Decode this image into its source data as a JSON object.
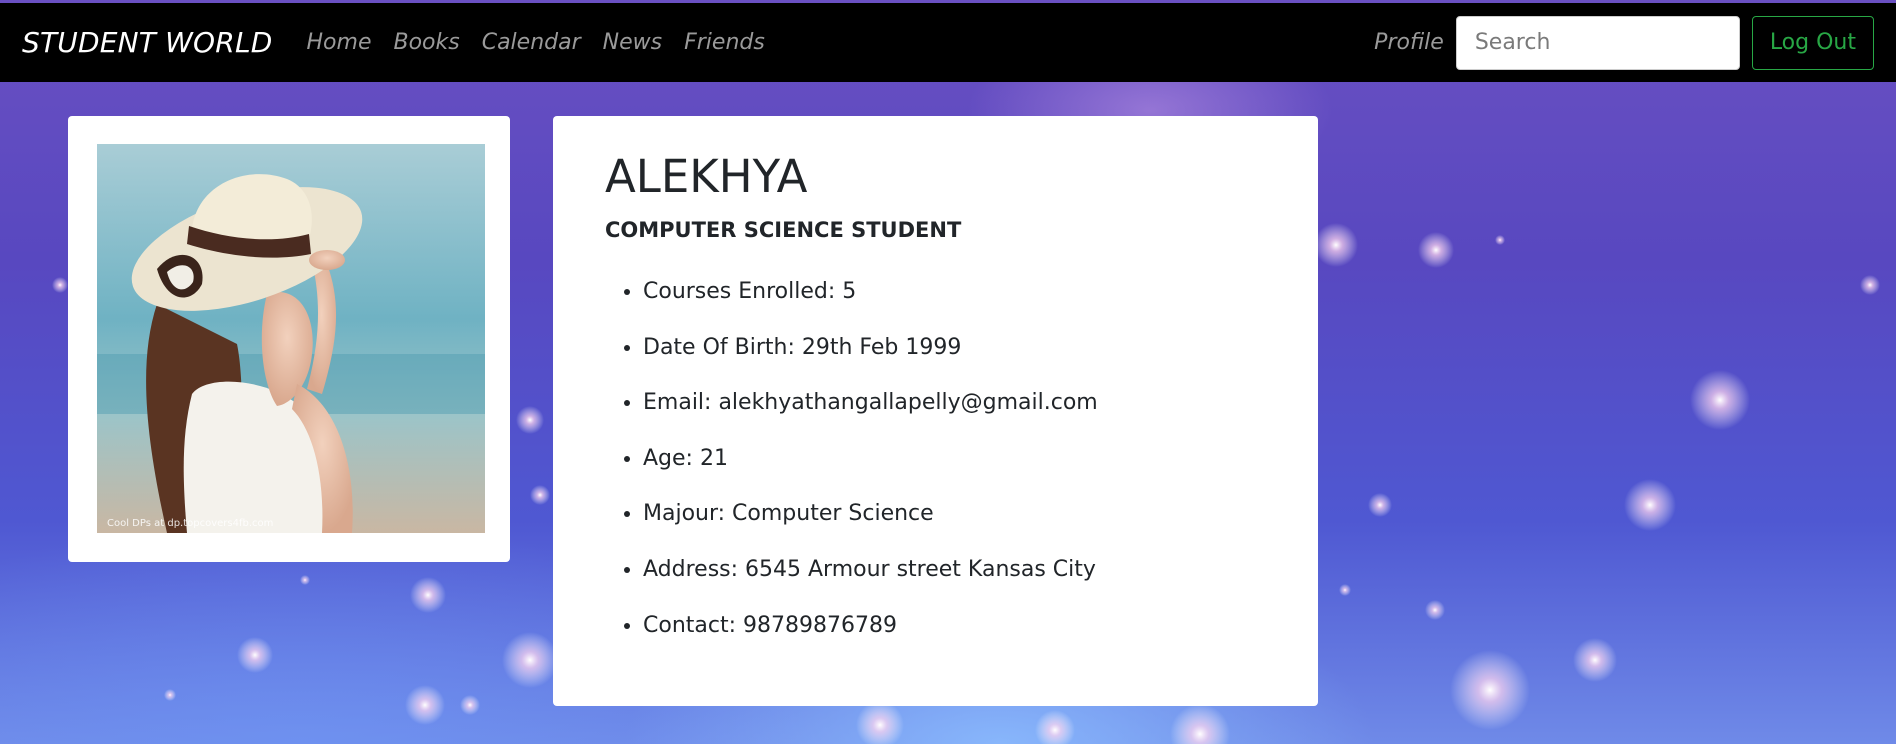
{
  "navbar": {
    "brand": "STUDENT WORLD",
    "links": [
      "Home",
      "Books",
      "Calendar",
      "News",
      "Friends"
    ],
    "profile": "Profile",
    "search_placeholder": "Search",
    "logout": "Log Out"
  },
  "photo": {
    "watermark": "Cool DPs at dp.topcovers4fb.com"
  },
  "profile": {
    "name": "ALEKHYA",
    "title": "COMPUTER SCIENCE STUDENT",
    "details": [
      "Courses Enrolled: 5",
      "Date Of Birth: 29th Feb 1999",
      "Email: alekhyathangallapelly@gmail.com",
      "Age: 21",
      "Majour: Computer Science",
      "Address: 6545 Armour street Kansas City",
      "Contact: 98789876789"
    ]
  },
  "colors": {
    "navbar": "#000000",
    "nav_link": "#9a9a9a",
    "logout_accent": "#28a745",
    "card": "#ffffff",
    "text": "#212529"
  }
}
